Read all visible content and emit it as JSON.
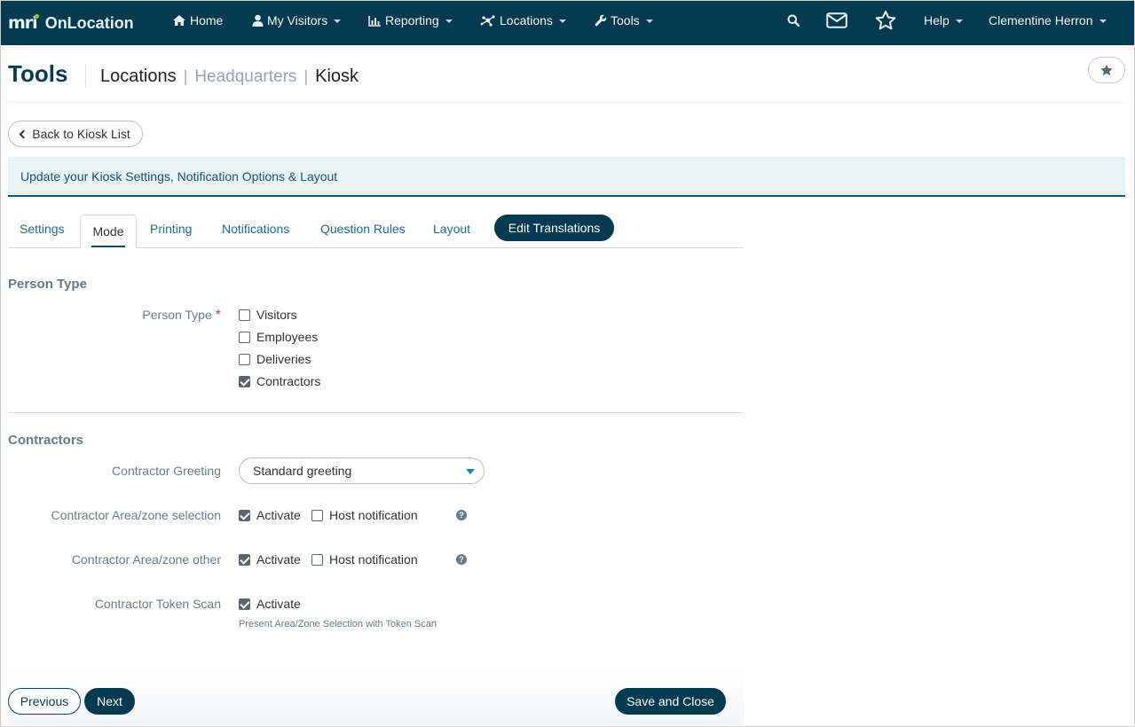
{
  "nav": {
    "logo": "mri",
    "brand": "OnLocation",
    "items": [
      {
        "label": "Home",
        "icon": "home-icon"
      },
      {
        "label": "My Visitors",
        "icon": "user-icon"
      },
      {
        "label": "Reporting",
        "icon": "bar-chart-icon"
      },
      {
        "label": "Locations",
        "icon": "network-icon"
      },
      {
        "label": "Tools",
        "icon": "wrench-icon"
      }
    ],
    "help": "Help",
    "user": "Clementine Herron"
  },
  "header": {
    "title": "Tools",
    "breadcrumb": [
      "Locations",
      "Headquarters",
      "Kiosk"
    ]
  },
  "back_button": "Back to Kiosk List",
  "info_text": "Update your Kiosk Settings, Notification Options & Layout",
  "tabs": [
    "Settings",
    "Mode",
    "Printing",
    "Notifications",
    "Question Rules",
    "Layout"
  ],
  "active_tab": "Mode",
  "edit_translations": "Edit Translations",
  "person_type_section": {
    "heading": "Person Type",
    "label": "Person Type",
    "required_mark": "*",
    "options": [
      {
        "label": "Visitors",
        "checked": false
      },
      {
        "label": "Employees",
        "checked": false
      },
      {
        "label": "Deliveries",
        "checked": false
      },
      {
        "label": "Contractors",
        "checked": true
      }
    ]
  },
  "contractors_section": {
    "heading": "Contractors",
    "greeting_label": "Contractor Greeting",
    "greeting_value": "Standard greeting",
    "area_selection_label": "Contractor Area/zone selection",
    "area_other_label": "Contractor Area/zone other",
    "token_scan_label": "Contractor Token Scan",
    "activate": "Activate",
    "host_notification": "Host notification",
    "help_glyph": "?",
    "token_hint": "Present Area/Zone Selection with Token Scan"
  },
  "footer": {
    "previous": "Previous",
    "next": "Next",
    "save_close": "Save and Close"
  },
  "colors": {
    "navbar": "#053b50",
    "accent": "#0a5c7a",
    "link": "#1f6c96",
    "info_bg": "#e6f4f5",
    "required": "#d0344e"
  }
}
